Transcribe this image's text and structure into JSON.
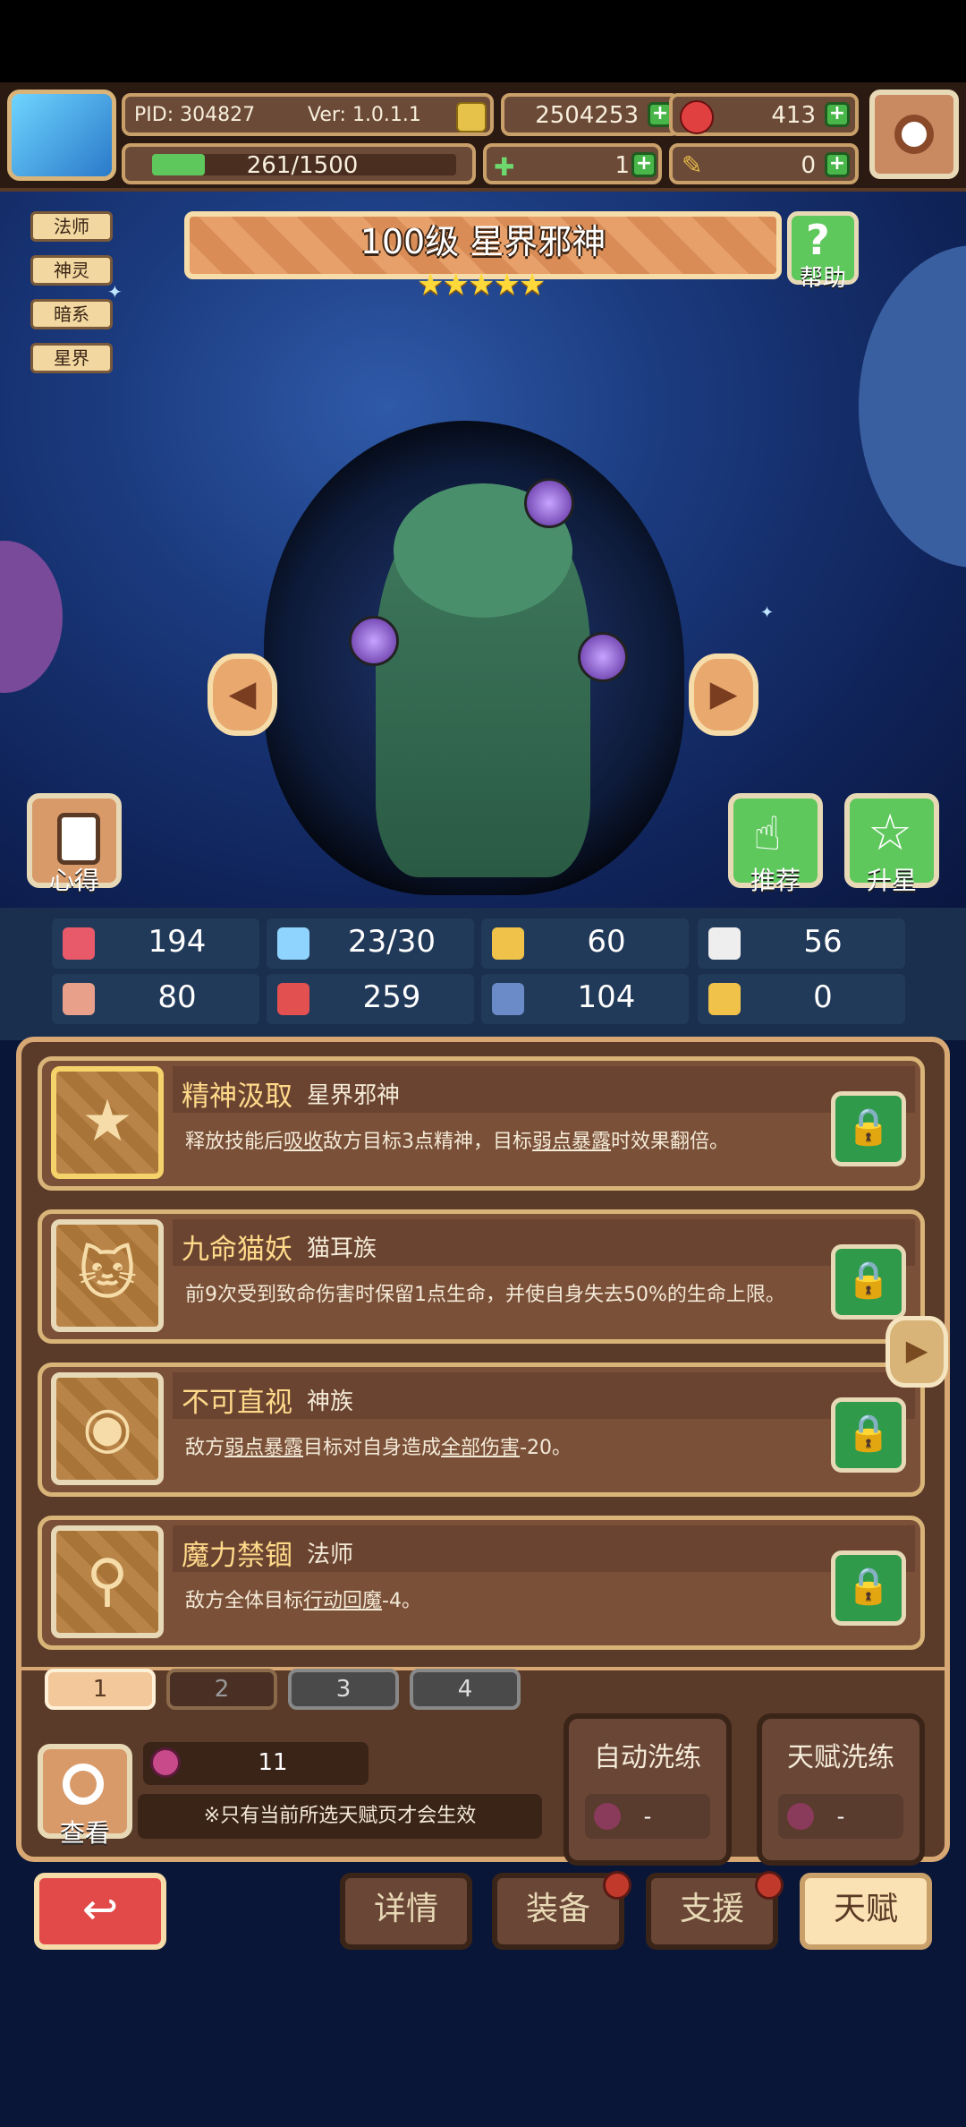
{
  "header": {
    "pid": "PID: 304827",
    "version": "Ver: 1.0.1.1",
    "coins": "2504253",
    "gems": "413",
    "energy": "261/1500",
    "energy_fraction": 0.174,
    "clover": "1",
    "tickets": "0"
  },
  "hero": {
    "class_tags": [
      "法师",
      "神灵",
      "暗系",
      "星界"
    ],
    "title": "100级  星界邪神",
    "stars": 5,
    "star_glyphs": "★★★★★"
  },
  "buttons": {
    "help": "帮助",
    "notes": "心得",
    "recommend": "推荐",
    "upgrade_star": "升星",
    "view": "查看"
  },
  "stats": [
    {
      "icon": "heart-icon",
      "value": "194"
    },
    {
      "icon": "water-drop-icon",
      "value": "23/30"
    },
    {
      "icon": "shield-icon",
      "value": "60"
    },
    {
      "icon": "wing-icon",
      "value": "56"
    },
    {
      "icon": "fist-icon",
      "value": "80"
    },
    {
      "icon": "book-icon",
      "value": "259"
    },
    {
      "icon": "boot-icon",
      "value": "104"
    },
    {
      "icon": "horseshoe-icon",
      "value": "0"
    }
  ],
  "talents": [
    {
      "name": "精神汲取",
      "sub": "星界邪神",
      "desc_parts": [
        "释放技能后",
        "吸收",
        "敌方目标3点精神，目标",
        "弱点暴露",
        "时效果翻倍。"
      ],
      "icon": "star-icon"
    },
    {
      "name": "九命猫妖",
      "sub": "猫耳族",
      "desc_parts": [
        "前9次受到致命伤害时保留1点生命，并使自身失去50%的生命上限。"
      ],
      "icon": "cat-icon"
    },
    {
      "name": "不可直视",
      "sub": "神族",
      "desc_parts": [
        "敌方",
        "弱点暴露",
        "目标对自身造成",
        "全部伤害",
        "-20。"
      ],
      "icon": "eye-icon"
    },
    {
      "name": "魔力禁锢",
      "sub": "法师",
      "desc_parts": [
        "敌方全体目标",
        "行动回魔",
        "-4。"
      ],
      "icon": "staff-icon"
    }
  ],
  "pages": [
    "1",
    "2",
    "3",
    "4"
  ],
  "essence_count": "11",
  "notice": "※只有当前所选天赋页才会生效",
  "wash": {
    "auto": "自动洗练",
    "talent": "天赋洗练",
    "auto_value": "-",
    "talent_value": "-"
  },
  "nav": {
    "details": "详情",
    "equipment": "装备",
    "support": "支援",
    "talent": "天赋"
  },
  "colors": {
    "accent_gold": "#d8b47a",
    "green_button": "#5ec85c",
    "back_red": "#e24a4a",
    "active_tab": "#fbe2b4"
  }
}
